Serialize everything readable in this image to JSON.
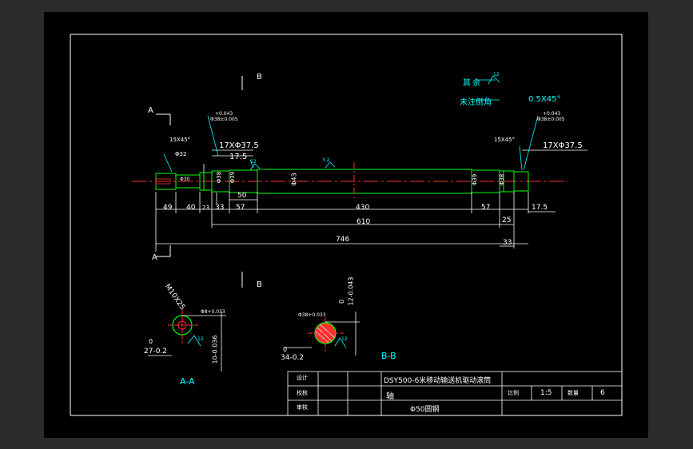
{
  "colors": {
    "background": "#000000",
    "outer_bg": "#2b2b2b",
    "frame": "#ffffff",
    "outline": "#00ff00",
    "dimension": "#ffffff",
    "annotation": "#00ffff",
    "centerline": "#ff0000"
  },
  "notes": {
    "remaining_label": "其余",
    "unnoted_chamfer": "未注倒角",
    "chamfer_value": "0.5X45°"
  },
  "section_marks": {
    "a_top": "A",
    "a_bottom": "A",
    "b_top": "B",
    "b_bottom": "B",
    "aa_label": "A-A",
    "bb_label": "B-B"
  },
  "chamfers": {
    "left": "15X45°",
    "right": "15X45°"
  },
  "tolerances": {
    "left_upper": "+0.043",
    "left_lower": "Φ38±0.005",
    "right_upper": "+0.043",
    "right_lower": "Φ38±0.005"
  },
  "diameters": {
    "d32": "Φ32",
    "left_top": "17XΦ37.5",
    "right_top": "17XΦ37.5",
    "len_left": "17.5",
    "d38a": "Φ38",
    "d39a": "Φ39",
    "d43": "Φ43",
    "d39b": "Φ39",
    "d38b": "Φ38",
    "dia_left_end": "Φ30"
  },
  "dimensions": {
    "d49": "49",
    "d40": "40",
    "d23": "23",
    "d33": "33",
    "d57a": "57",
    "d50": "50",
    "d430": "430",
    "d57b": "57",
    "d25": "25",
    "d17_5r": "17.5",
    "d610": "610",
    "d746": "746",
    "d33b": "33"
  },
  "roughness": {
    "r1": "12",
    "r2": "3.2",
    "r3": "12",
    "r4": "12",
    "r5": "12"
  },
  "section_aa": {
    "thread": "M10X25",
    "keyway_tol": "Φ8+0.033",
    "zero": "0",
    "dim_h": "27-0.2",
    "dim_w": "10-0.036"
  },
  "section_bb": {
    "keyway_tol": "Φ38+0.033",
    "zero_h": "0",
    "dim_h": "34-0.2",
    "zero_w": "0",
    "dim_w": "12-0.043"
  },
  "title_block": {
    "row1_label": "设计",
    "row2_label": "校核",
    "row3_label": "审核",
    "title": "DSY500-6米移动输送机驱动滚筒",
    "part": "轴",
    "material": "Φ50圆钢",
    "ratio_label": "比例",
    "ratio": "1:5",
    "qty_label": "数量",
    "qty": "6"
  }
}
